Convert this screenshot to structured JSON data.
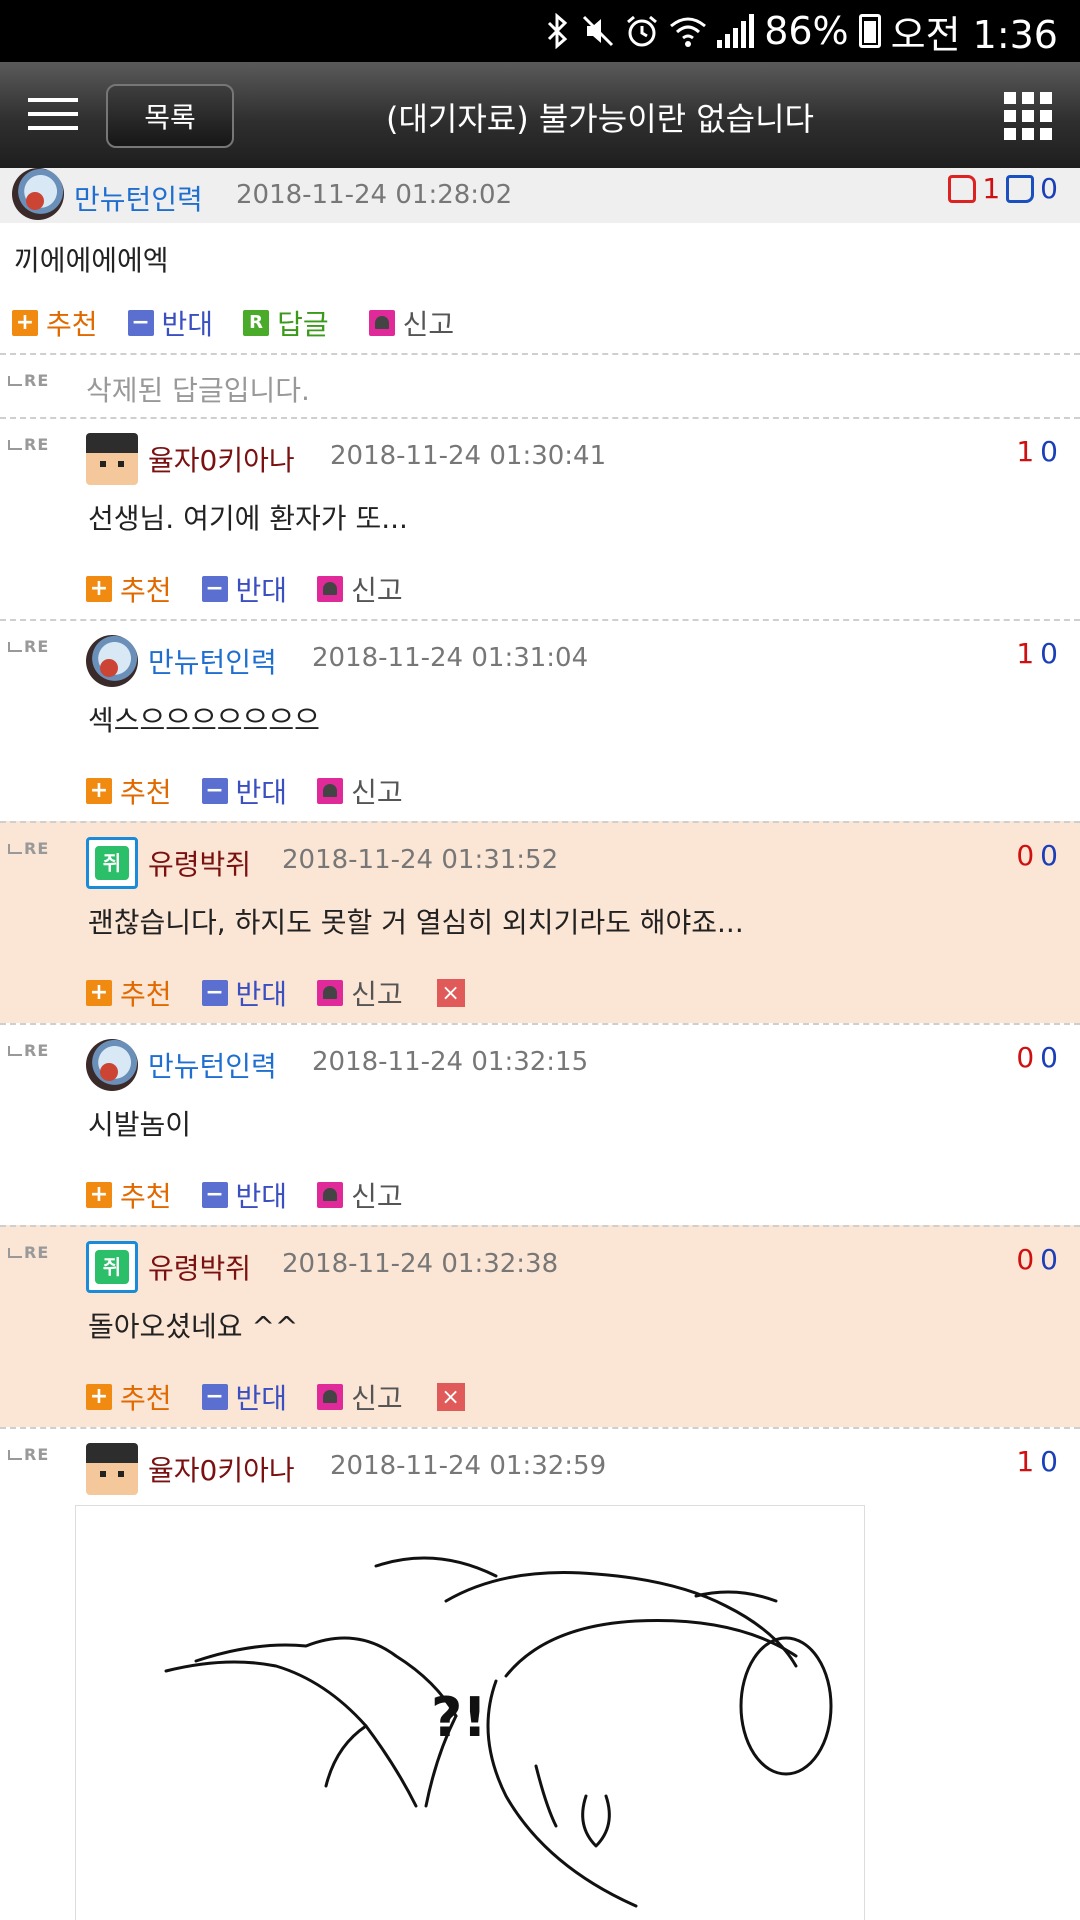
{
  "status_bar": {
    "battery": "86%",
    "time": "오전 1:36"
  },
  "header": {
    "list_button": "목록",
    "title": "(대기자료) 불가능이란 없습니다"
  },
  "original_post": {
    "author": "만뉴턴인력",
    "date": "2018-11-24 01:28:02",
    "up": "1",
    "down": "0",
    "text": "끼에에에에엑",
    "actions": {
      "recommend": "추천",
      "oppose": "반대",
      "reply": "답글",
      "report": "신고"
    }
  },
  "deleted_reply": "삭제된 답글입니다.",
  "comments": [
    {
      "author": "율자0키아나",
      "date": "2018-11-24 01:30:41",
      "up": "1",
      "down": "0",
      "text": "선생님. 여기에 환자가 또..."
    },
    {
      "author": "만뉴턴인력",
      "date": "2018-11-24 01:31:04",
      "up": "1",
      "down": "0",
      "text": "섹스으으으으으으으"
    },
    {
      "author": "유령박쥐",
      "date": "2018-11-24 01:31:52",
      "up": "0",
      "down": "0",
      "text": "괜찮습니다, 하지도 못할 거 열심히 외치기라도 해야죠..."
    },
    {
      "author": "만뉴턴인력",
      "date": "2018-11-24 01:32:15",
      "up": "0",
      "down": "0",
      "text": "시발놈이"
    },
    {
      "author": "유령박쥐",
      "date": "2018-11-24 01:32:38",
      "up": "0",
      "down": "0",
      "text": "돌아오셨네요 ^^"
    },
    {
      "author": "율자0키아나",
      "date": "2018-11-24 01:32:59",
      "up": "1",
      "down": "0"
    }
  ],
  "labels": {
    "recommend": "추천",
    "oppose": "반대",
    "report": "신고",
    "re": "RE"
  },
  "image_text": "?!"
}
